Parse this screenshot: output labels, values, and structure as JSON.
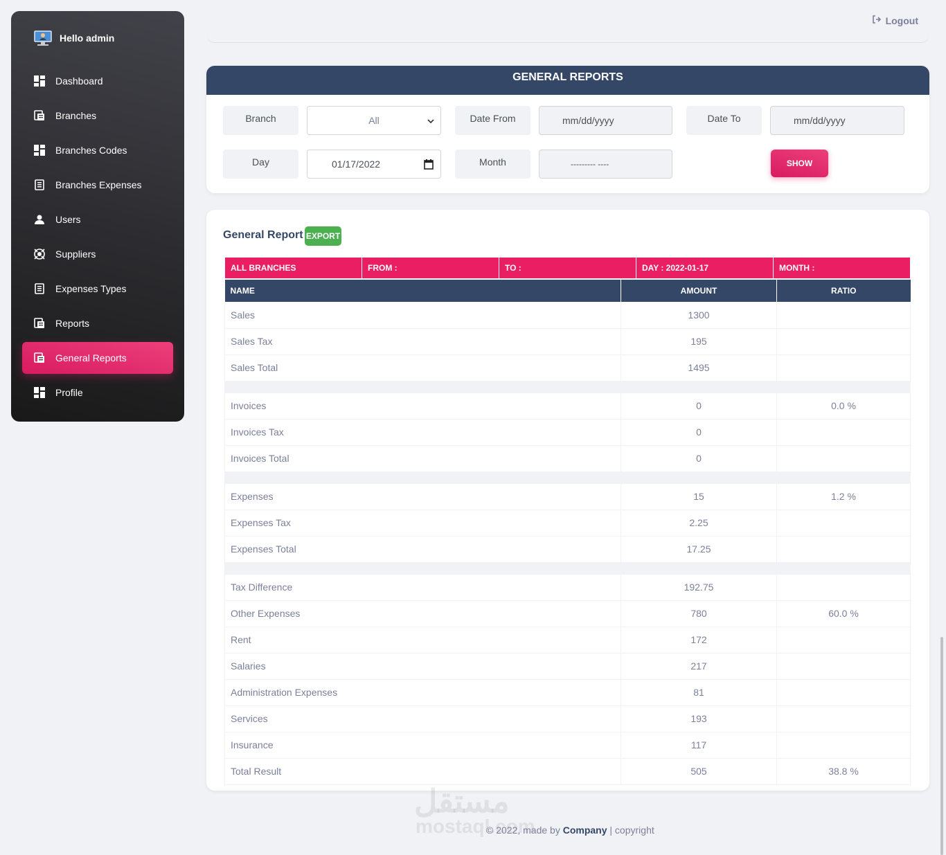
{
  "sidebar": {
    "greeting": "Hello admin",
    "items": [
      {
        "label": "Dashboard",
        "icon": "dashboard-icon"
      },
      {
        "label": "Branches",
        "icon": "receipt-icon"
      },
      {
        "label": "Branches Codes",
        "icon": "dashboard-icon"
      },
      {
        "label": "Branches Expenses",
        "icon": "document-icon"
      },
      {
        "label": "Users",
        "icon": "person-icon"
      },
      {
        "label": "Suppliers",
        "icon": "support-icon"
      },
      {
        "label": "Expenses Types",
        "icon": "document-icon"
      },
      {
        "label": "Reports",
        "icon": "receipt-icon"
      },
      {
        "label": "General Reports",
        "icon": "receipt-icon",
        "active": true
      },
      {
        "label": "Profile",
        "icon": "dashboard-icon"
      }
    ]
  },
  "topbar": {
    "logout_label": "Logout"
  },
  "filters": {
    "title": "GENERAL REPORTS",
    "branch_label": "Branch",
    "branch_value": "All",
    "date_from_label": "Date From",
    "date_from_placeholder": "mm/dd/yyyy",
    "date_to_label": "Date To",
    "date_to_placeholder": "mm/dd/yyyy",
    "day_label": "Day",
    "day_value": "01/17/2022",
    "month_label": "Month",
    "month_value": "--------- ----",
    "show_label": "SHOW"
  },
  "report": {
    "title": "General Report",
    "export_label": "EXPORT",
    "info": [
      "ALL BRANCHES",
      "FROM :",
      "TO :",
      "DAY : 2022-01-17",
      "MONTH :"
    ],
    "headers": [
      "NAME",
      "AMOUNT",
      "RATIO"
    ],
    "rows": [
      {
        "name": "Sales",
        "amount": "1300",
        "ratio": ""
      },
      {
        "name": "Sales Tax",
        "amount": "195",
        "ratio": ""
      },
      {
        "name": "Sales Total",
        "amount": "1495",
        "ratio": ""
      },
      {
        "spacer": true
      },
      {
        "name": "Invoices",
        "amount": "0",
        "ratio": "0.0 %"
      },
      {
        "name": "Invoices Tax",
        "amount": "0",
        "ratio": ""
      },
      {
        "name": "Invoices Total",
        "amount": "0",
        "ratio": ""
      },
      {
        "spacer": true
      },
      {
        "name": "Expenses",
        "amount": "15",
        "ratio": "1.2 %"
      },
      {
        "name": "Expenses Tax",
        "amount": "2.25",
        "ratio": ""
      },
      {
        "name": "Expenses Total",
        "amount": "17.25",
        "ratio": ""
      },
      {
        "spacer": true
      },
      {
        "name": "Tax Difference",
        "amount": "192.75",
        "ratio": ""
      },
      {
        "name": "Other Expenses",
        "amount": "780",
        "ratio": "60.0 %"
      },
      {
        "name": "Rent",
        "amount": "172",
        "ratio": ""
      },
      {
        "name": "Salaries",
        "amount": "217",
        "ratio": ""
      },
      {
        "name": "Administration Expenses",
        "amount": "81",
        "ratio": ""
      },
      {
        "name": "Services",
        "amount": "193",
        "ratio": ""
      },
      {
        "name": "Insurance",
        "amount": "117",
        "ratio": ""
      },
      {
        "name": "Total Result",
        "amount": "505",
        "ratio": "38.8 %"
      }
    ]
  },
  "footer": {
    "prefix": "© 2022, made by",
    "company": "Company",
    "suffix": "| copyright"
  },
  "watermark": {
    "arabic": "مستقل",
    "latin": "mostaql.com"
  }
}
